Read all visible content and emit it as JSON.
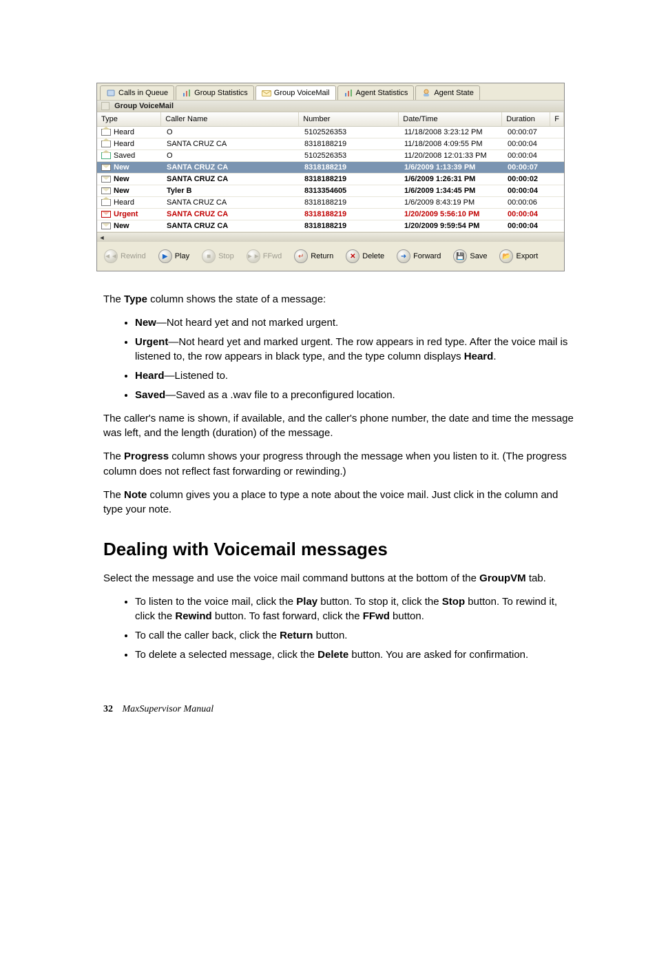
{
  "tabs": {
    "calls_in_queue": "Calls in Queue",
    "group_statistics": "Group Statistics",
    "group_voicemail": "Group VoiceMail",
    "agent_statistics": "Agent Statistics",
    "agent_state": "Agent State"
  },
  "subheader": "Group VoiceMail",
  "grid": {
    "columns": {
      "type": "Type",
      "caller": "Caller Name",
      "number": "Number",
      "date": "Date/Time",
      "duration": "Duration",
      "f": "F"
    },
    "rows": [
      {
        "type": "Heard",
        "style": "normal",
        "icon": "open",
        "caller": "O",
        "number": "5102526353",
        "date": "11/18/2008 3:23:12 PM",
        "dur": "00:00:07"
      },
      {
        "type": "Heard",
        "style": "normal",
        "icon": "open",
        "caller": "SANTA CRUZ CA",
        "number": "8318188219",
        "date": "11/18/2008 4:09:55 PM",
        "dur": "00:00:04"
      },
      {
        "type": "Saved",
        "style": "normal",
        "icon": "saved",
        "caller": "O",
        "number": "5102526353",
        "date": "11/20/2008 12:01:33 PM",
        "dur": "00:00:04"
      },
      {
        "type": "New",
        "style": "selected",
        "icon": "sealed",
        "caller": "SANTA CRUZ  CA",
        "number": "8318188219",
        "date": "1/6/2009 1:13:39 PM",
        "dur": "00:00:07"
      },
      {
        "type": "New",
        "style": "bold",
        "icon": "sealed",
        "caller": "SANTA CRUZ  CA",
        "number": "8318188219",
        "date": "1/6/2009 1:26:31 PM",
        "dur": "00:00:02"
      },
      {
        "type": "New",
        "style": "bold",
        "icon": "sealed",
        "caller": "Tyler B",
        "number": "8313354605",
        "date": "1/6/2009 1:34:45 PM",
        "dur": "00:00:04"
      },
      {
        "type": "Heard",
        "style": "normal",
        "icon": "open",
        "caller": "SANTA CRUZ CA",
        "number": "8318188219",
        "date": "1/6/2009 8:43:19 PM",
        "dur": "00:00:06"
      },
      {
        "type": "Urgent",
        "style": "red",
        "icon": "redenv",
        "caller": "SANTA CRUZ  CA",
        "number": "8318188219",
        "date": "1/20/2009 5:56:10 PM",
        "dur": "00:00:04"
      },
      {
        "type": "New",
        "style": "bold",
        "icon": "sealed",
        "caller": "SANTA CRUZ  CA",
        "number": "8318188219",
        "date": "1/20/2009 9:59:54 PM",
        "dur": "00:00:04"
      }
    ]
  },
  "buttons": {
    "rewind": "Rewind",
    "play": "Play",
    "stop": "Stop",
    "ffwd": "FFwd",
    "return": "Return",
    "delete": "Delete",
    "forward": "Forward",
    "save": "Save",
    "export": "Export"
  },
  "doc": {
    "p_type_intro_a": "The ",
    "p_type_intro_b": "Type",
    "p_type_intro_c": " column shows the state of a message:",
    "li_new_a": "New",
    "li_new_b": "—Not heard yet and not marked urgent.",
    "li_urgent_a": "Urgent",
    "li_urgent_b": "—Not heard yet and marked urgent. The row appears in red type. After the voice mail is listened to, the row appears in black type, and the type column displays ",
    "li_urgent_c": "Heard",
    "li_urgent_d": ".",
    "li_heard_a": "Heard",
    "li_heard_b": "—Listened to.",
    "li_saved_a": "Saved",
    "li_saved_b": "—Saved as a .wav file to a preconfigured location.",
    "p_caller": "The caller's name is shown, if available, and the caller's phone number, the date and time the message was left, and the length (duration) of the message.",
    "p_progress_a": "The ",
    "p_progress_b": "Progress",
    "p_progress_c": " column shows your progress through the message when you listen to it. (The progress column does not reflect fast forwarding or rewinding.)",
    "p_note_a": "The ",
    "p_note_b": "Note",
    "p_note_c": " column gives you a place to type a note about the voice mail. Just click in the column and type your note.",
    "h2": "Dealing with Voicemail messages",
    "p_select_a": "Select the message and use the voice mail command buttons at the bottom of the ",
    "p_select_b": "GroupVM",
    "p_select_c": " tab.",
    "li_play_a": "To listen to the voice mail, click the ",
    "li_play_b": "Play",
    "li_play_c": " button. To stop it, click the ",
    "li_play_d": "Stop",
    "li_play_e": " button. To rewind it, click the ",
    "li_play_f": "Rewind",
    "li_play_g": " button. To fast forward, click the ",
    "li_play_h": "FFwd",
    "li_play_i": " button.",
    "li_return_a": "To call the caller back, click the ",
    "li_return_b": "Return",
    "li_return_c": " button.",
    "li_delete_a": "To delete a selected message, click the ",
    "li_delete_b": "Delete",
    "li_delete_c": " button. You are asked for confirmation.",
    "footer_page": "32",
    "footer_title": "MaxSupervisor Manual"
  }
}
